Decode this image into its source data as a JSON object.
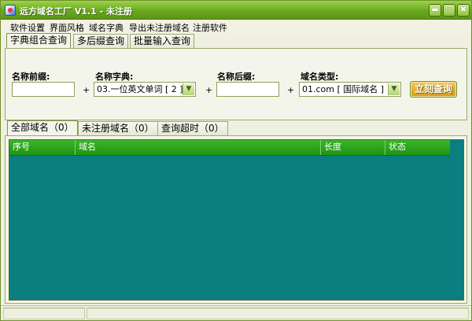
{
  "window": {
    "title": "远方域名工厂 V1.1 - 未注册",
    "controls": [
      "▬",
      "▢",
      "✖"
    ]
  },
  "menu": [
    "软件设置",
    "界面风格",
    "域名字典",
    "导出未注册域名",
    "注册软件"
  ],
  "top_tabs": [
    "字典组合查询",
    "多后缀查询",
    "批量输入查询"
  ],
  "form": {
    "prefix_label": "名称前缀:",
    "prefix_value": "",
    "dict_label": "名称字典:",
    "dict_value": "03.一位英文单词 [ 2 ]",
    "suffix_label": "名称后缀:",
    "suffix_value": "",
    "type_label": "域名类型:",
    "type_value": "01.com [ 国际域名 ]",
    "plus": "+",
    "query_button": "立刻查询"
  },
  "result_tabs": [
    "全部域名（0）",
    "未注册域名（0）",
    "查询超时（0）"
  ],
  "grid": {
    "columns": [
      "序号",
      "域名",
      "长度",
      "状态"
    ],
    "rows": []
  },
  "colors": {
    "titlebar": "#6aa81f",
    "grid_bg": "#0b7f80",
    "header_bg": "#1f9415",
    "button": "#d79a18"
  }
}
